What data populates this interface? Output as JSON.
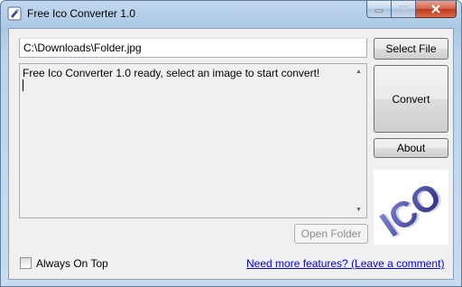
{
  "window": {
    "title": "Free Ico Converter 1.0"
  },
  "caption_buttons": {
    "minimize": "minimize-icon",
    "maximize": "maximize-icon",
    "close": "close-icon"
  },
  "file": {
    "path": "C:\\Downloads\\Folder.jpg"
  },
  "buttons": {
    "select_file": "Select File",
    "convert": "Convert",
    "about": "About",
    "open_folder": "Open Folder"
  },
  "log": {
    "text": "Free Ico Converter 1.0 ready, select an image to start convert!"
  },
  "preview": {
    "logo_text": "ICO"
  },
  "options": {
    "always_on_top_label": "Always On Top",
    "always_on_top_checked": false
  },
  "footer": {
    "link_text": "Need more features? (Leave a comment)"
  }
}
